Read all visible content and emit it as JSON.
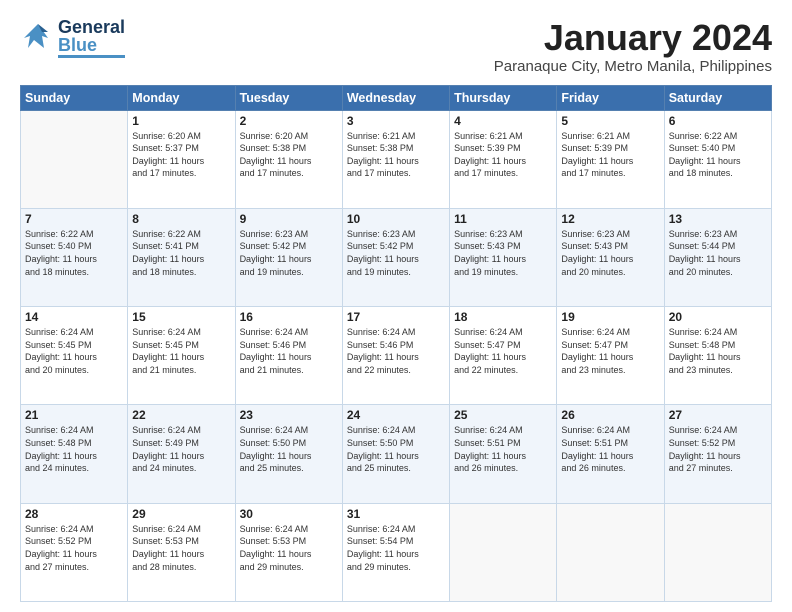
{
  "header": {
    "logo_general": "General",
    "logo_blue": "Blue",
    "month_year": "January 2024",
    "location": "Paranaque City, Metro Manila, Philippines"
  },
  "days_of_week": [
    "Sunday",
    "Monday",
    "Tuesday",
    "Wednesday",
    "Thursday",
    "Friday",
    "Saturday"
  ],
  "weeks": [
    [
      {
        "day": "",
        "sunrise": "",
        "sunset": "",
        "daylight": ""
      },
      {
        "day": "1",
        "sunrise": "Sunrise: 6:20 AM",
        "sunset": "Sunset: 5:37 PM",
        "daylight": "Daylight: 11 hours and 17 minutes."
      },
      {
        "day": "2",
        "sunrise": "Sunrise: 6:20 AM",
        "sunset": "Sunset: 5:38 PM",
        "daylight": "Daylight: 11 hours and 17 minutes."
      },
      {
        "day": "3",
        "sunrise": "Sunrise: 6:21 AM",
        "sunset": "Sunset: 5:38 PM",
        "daylight": "Daylight: 11 hours and 17 minutes."
      },
      {
        "day": "4",
        "sunrise": "Sunrise: 6:21 AM",
        "sunset": "Sunset: 5:39 PM",
        "daylight": "Daylight: 11 hours and 17 minutes."
      },
      {
        "day": "5",
        "sunrise": "Sunrise: 6:21 AM",
        "sunset": "Sunset: 5:39 PM",
        "daylight": "Daylight: 11 hours and 17 minutes."
      },
      {
        "day": "6",
        "sunrise": "Sunrise: 6:22 AM",
        "sunset": "Sunset: 5:40 PM",
        "daylight": "Daylight: 11 hours and 18 minutes."
      }
    ],
    [
      {
        "day": "7",
        "sunrise": "Sunrise: 6:22 AM",
        "sunset": "Sunset: 5:40 PM",
        "daylight": "Daylight: 11 hours and 18 minutes."
      },
      {
        "day": "8",
        "sunrise": "Sunrise: 6:22 AM",
        "sunset": "Sunset: 5:41 PM",
        "daylight": "Daylight: 11 hours and 18 minutes."
      },
      {
        "day": "9",
        "sunrise": "Sunrise: 6:23 AM",
        "sunset": "Sunset: 5:42 PM",
        "daylight": "Daylight: 11 hours and 19 minutes."
      },
      {
        "day": "10",
        "sunrise": "Sunrise: 6:23 AM",
        "sunset": "Sunset: 5:42 PM",
        "daylight": "Daylight: 11 hours and 19 minutes."
      },
      {
        "day": "11",
        "sunrise": "Sunrise: 6:23 AM",
        "sunset": "Sunset: 5:43 PM",
        "daylight": "Daylight: 11 hours and 19 minutes."
      },
      {
        "day": "12",
        "sunrise": "Sunrise: 6:23 AM",
        "sunset": "Sunset: 5:43 PM",
        "daylight": "Daylight: 11 hours and 20 minutes."
      },
      {
        "day": "13",
        "sunrise": "Sunrise: 6:23 AM",
        "sunset": "Sunset: 5:44 PM",
        "daylight": "Daylight: 11 hours and 20 minutes."
      }
    ],
    [
      {
        "day": "14",
        "sunrise": "Sunrise: 6:24 AM",
        "sunset": "Sunset: 5:45 PM",
        "daylight": "Daylight: 11 hours and 20 minutes."
      },
      {
        "day": "15",
        "sunrise": "Sunrise: 6:24 AM",
        "sunset": "Sunset: 5:45 PM",
        "daylight": "Daylight: 11 hours and 21 minutes."
      },
      {
        "day": "16",
        "sunrise": "Sunrise: 6:24 AM",
        "sunset": "Sunset: 5:46 PM",
        "daylight": "Daylight: 11 hours and 21 minutes."
      },
      {
        "day": "17",
        "sunrise": "Sunrise: 6:24 AM",
        "sunset": "Sunset: 5:46 PM",
        "daylight": "Daylight: 11 hours and 22 minutes."
      },
      {
        "day": "18",
        "sunrise": "Sunrise: 6:24 AM",
        "sunset": "Sunset: 5:47 PM",
        "daylight": "Daylight: 11 hours and 22 minutes."
      },
      {
        "day": "19",
        "sunrise": "Sunrise: 6:24 AM",
        "sunset": "Sunset: 5:47 PM",
        "daylight": "Daylight: 11 hours and 23 minutes."
      },
      {
        "day": "20",
        "sunrise": "Sunrise: 6:24 AM",
        "sunset": "Sunset: 5:48 PM",
        "daylight": "Daylight: 11 hours and 23 minutes."
      }
    ],
    [
      {
        "day": "21",
        "sunrise": "Sunrise: 6:24 AM",
        "sunset": "Sunset: 5:48 PM",
        "daylight": "Daylight: 11 hours and 24 minutes."
      },
      {
        "day": "22",
        "sunrise": "Sunrise: 6:24 AM",
        "sunset": "Sunset: 5:49 PM",
        "daylight": "Daylight: 11 hours and 24 minutes."
      },
      {
        "day": "23",
        "sunrise": "Sunrise: 6:24 AM",
        "sunset": "Sunset: 5:50 PM",
        "daylight": "Daylight: 11 hours and 25 minutes."
      },
      {
        "day": "24",
        "sunrise": "Sunrise: 6:24 AM",
        "sunset": "Sunset: 5:50 PM",
        "daylight": "Daylight: 11 hours and 25 minutes."
      },
      {
        "day": "25",
        "sunrise": "Sunrise: 6:24 AM",
        "sunset": "Sunset: 5:51 PM",
        "daylight": "Daylight: 11 hours and 26 minutes."
      },
      {
        "day": "26",
        "sunrise": "Sunrise: 6:24 AM",
        "sunset": "Sunset: 5:51 PM",
        "daylight": "Daylight: 11 hours and 26 minutes."
      },
      {
        "day": "27",
        "sunrise": "Sunrise: 6:24 AM",
        "sunset": "Sunset: 5:52 PM",
        "daylight": "Daylight: 11 hours and 27 minutes."
      }
    ],
    [
      {
        "day": "28",
        "sunrise": "Sunrise: 6:24 AM",
        "sunset": "Sunset: 5:52 PM",
        "daylight": "Daylight: 11 hours and 27 minutes."
      },
      {
        "day": "29",
        "sunrise": "Sunrise: 6:24 AM",
        "sunset": "Sunset: 5:53 PM",
        "daylight": "Daylight: 11 hours and 28 minutes."
      },
      {
        "day": "30",
        "sunrise": "Sunrise: 6:24 AM",
        "sunset": "Sunset: 5:53 PM",
        "daylight": "Daylight: 11 hours and 29 minutes."
      },
      {
        "day": "31",
        "sunrise": "Sunrise: 6:24 AM",
        "sunset": "Sunset: 5:54 PM",
        "daylight": "Daylight: 11 hours and 29 minutes."
      },
      {
        "day": "",
        "sunrise": "",
        "sunset": "",
        "daylight": ""
      },
      {
        "day": "",
        "sunrise": "",
        "sunset": "",
        "daylight": ""
      },
      {
        "day": "",
        "sunrise": "",
        "sunset": "",
        "daylight": ""
      }
    ]
  ]
}
